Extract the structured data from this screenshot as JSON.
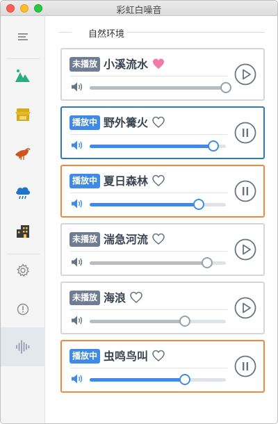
{
  "window": {
    "title": "彩虹白噪音"
  },
  "sidebar": {
    "items": [
      {
        "icon": "menu-icon"
      },
      {
        "icon": "mountain-icon"
      },
      {
        "icon": "shop-icon"
      },
      {
        "icon": "bird-icon"
      },
      {
        "icon": "rain-cloud-icon"
      },
      {
        "icon": "building-icon"
      },
      {
        "icon": "gear-icon"
      },
      {
        "icon": "info-icon"
      },
      {
        "icon": "sound-wave-icon"
      }
    ]
  },
  "section": {
    "title": "自然环境"
  },
  "sounds": [
    {
      "status": "未播放",
      "name": "小溪流水",
      "favorite": true,
      "playing": false,
      "volume": 1.0,
      "border": "#d3d6db"
    },
    {
      "status": "播放中",
      "name": "野外篝火",
      "favorite": false,
      "playing": true,
      "volume": 0.91,
      "border": "#2f76c6"
    },
    {
      "status": "播放中",
      "name": "夏日森林",
      "favorite": false,
      "playing": true,
      "volume": 0.8,
      "border": "#f0883a"
    },
    {
      "status": "未播放",
      "name": "湍急河流",
      "favorite": false,
      "playing": false,
      "volume": 0.86,
      "border": "#d3d6db"
    },
    {
      "status": "未播放",
      "name": "海浪",
      "favorite": false,
      "playing": false,
      "volume": 0.7,
      "border": "#d3d6db"
    },
    {
      "status": "播放中",
      "name": "虫鸣鸟叫",
      "favorite": false,
      "playing": true,
      "volume": 0.7,
      "border": "#f0883a"
    }
  ],
  "colors": {
    "accent": "#3f8ae6",
    "badge_idle": "#6e7d92",
    "heart": "#f07aa8",
    "text": "#3b4352"
  }
}
